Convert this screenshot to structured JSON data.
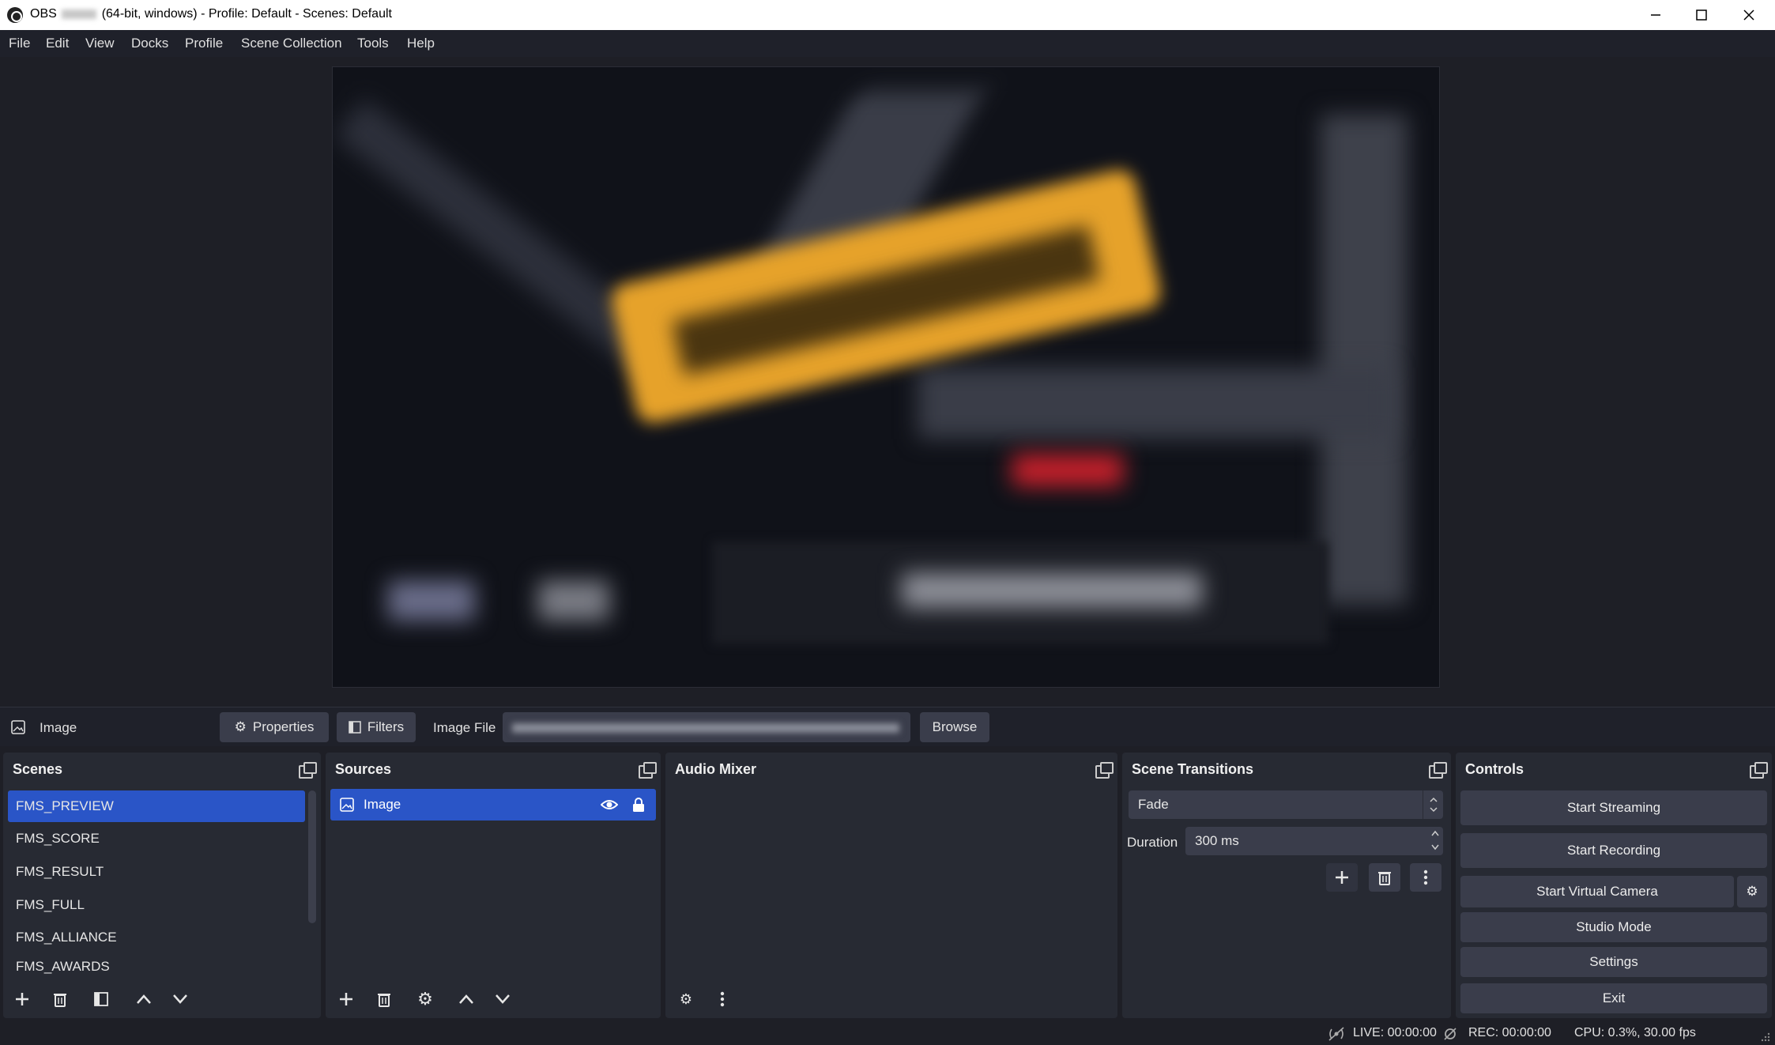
{
  "window": {
    "title_prefix": "OBS",
    "title_suffix": "(64-bit, windows) - Profile: Default - Scenes: Default",
    "minimize": "—",
    "maximize": "☐",
    "close": "✕"
  },
  "menu": [
    "File",
    "Edit",
    "View",
    "Docks",
    "Profile",
    "Scene Collection",
    "Tools",
    "Help"
  ],
  "source_toolbar": {
    "source_name": "Image",
    "properties_label": "Properties",
    "filters_label": "Filters",
    "image_file_label": "Image File",
    "browse_label": "Browse"
  },
  "scenes": {
    "title": "Scenes",
    "items": [
      "FMS_PREVIEW",
      "FMS_SCORE",
      "FMS_RESULT",
      "FMS_FULL",
      "FMS_ALLIANCE",
      "FMS_AWARDS"
    ],
    "selected_index": 0
  },
  "sources": {
    "title": "Sources",
    "items": [
      {
        "name": "Image",
        "visible": true,
        "locked": true
      }
    ]
  },
  "audio_mixer": {
    "title": "Audio Mixer"
  },
  "scene_transitions": {
    "title": "Scene Transitions",
    "transition": "Fade",
    "duration_label": "Duration",
    "duration_value": "300 ms"
  },
  "controls": {
    "title": "Controls",
    "start_streaming": "Start Streaming",
    "start_recording": "Start Recording",
    "start_virtual_camera": "Start Virtual Camera",
    "studio_mode": "Studio Mode",
    "settings": "Settings",
    "exit": "Exit"
  },
  "status": {
    "live": "LIVE: 00:00:00",
    "rec": "REC: 00:00:00",
    "cpu": "CPU: 0.3%, 30.00 fps"
  },
  "colors": {
    "selection": "#2a55c7",
    "dock_bg": "#272a33",
    "button_bg": "#3a3d4b"
  }
}
